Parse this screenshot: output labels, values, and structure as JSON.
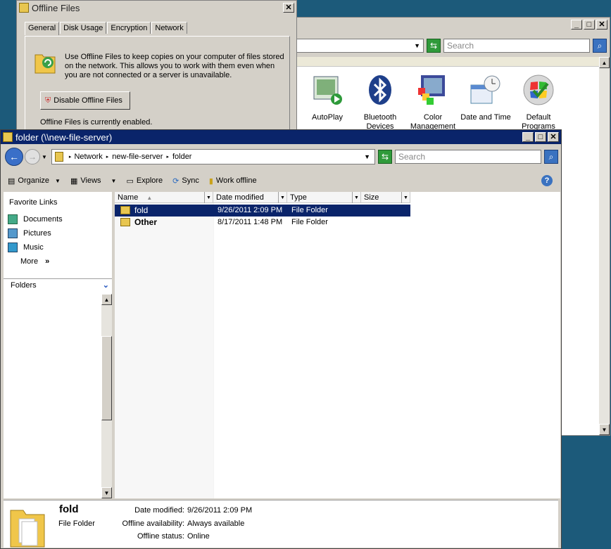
{
  "control_panel": {
    "search_placeholder": "Search",
    "items": [
      {
        "label": "AutoPlay",
        "icon": "autoplay-icon"
      },
      {
        "label": "Bluetooth Devices",
        "icon": "bluetooth-icon"
      },
      {
        "label": "Color Management",
        "icon": "color-management-icon"
      },
      {
        "label": "Date and Time",
        "icon": "date-time-icon"
      },
      {
        "label": "Default Programs",
        "icon": "default-programs-icon"
      }
    ]
  },
  "offline_dialog": {
    "title": "Offline Files",
    "tabs": [
      "General",
      "Disk Usage",
      "Encryption",
      "Network"
    ],
    "description": "Use Offline Files to keep copies on your computer of files stored on the network.  This allows you to work with them even when you are not connected or a server is unavailable.",
    "disable_button": "Disable Offline Files",
    "status": "Offline Files is currently enabled."
  },
  "explorer": {
    "title": "folder (\\\\new-file-server)",
    "breadcrumb": [
      "Network",
      "new-file-server",
      "folder"
    ],
    "search_placeholder": "Search",
    "commands": {
      "organize": "Organize",
      "views": "Views",
      "explore": "Explore",
      "sync": "Sync",
      "work_offline": "Work offline"
    },
    "favorite_links_title": "Favorite Links",
    "favorite_links": [
      "Documents",
      "Pictures",
      "Music"
    ],
    "more": "More",
    "folders_label": "Folders",
    "columns": [
      "Name",
      "Date modified",
      "Type",
      "Size"
    ],
    "files": [
      {
        "name": "fold",
        "date": "9/26/2011 2:09 PM",
        "type": "File Folder",
        "size": ""
      },
      {
        "name": "Other",
        "date": "8/17/2011 1:48 PM",
        "type": "File Folder",
        "size": ""
      }
    ],
    "details": {
      "name": "fold",
      "kind": "File Folder",
      "date_label": "Date modified:",
      "date_value": "9/26/2011 2:09 PM",
      "availability_label": "Offline availability:",
      "availability_value": "Always available",
      "status_label": "Offline status:",
      "status_value": "Online"
    }
  },
  "colors": {
    "desktop": "#1c5a7a",
    "active_title": "#0a246a",
    "inactive_title": "#808080",
    "selection": "#0a246a"
  }
}
